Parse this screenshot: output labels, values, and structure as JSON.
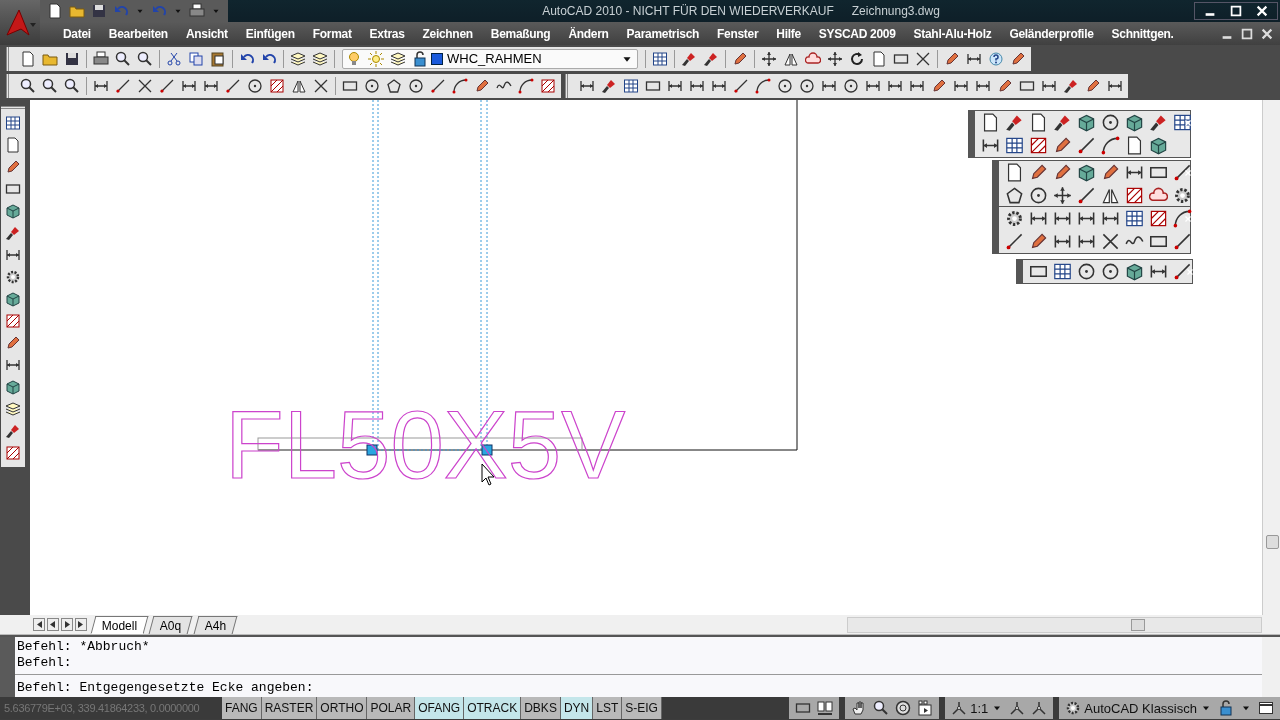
{
  "window": {
    "title": "AutoCAD 2010 - NICHT FÜR DEN WIEDERVERKAUF",
    "document": "Zeichnung3.dwg"
  },
  "menu": [
    "Datei",
    "Bearbeiten",
    "Ansicht",
    "Einfügen",
    "Format",
    "Extras",
    "Zeichnen",
    "Bemaßung",
    "Ändern",
    "Parametrisch",
    "Fenster",
    "Hilfe",
    "SYSCAD 2009",
    "Stahl-Alu-Holz",
    "Geländerprofile",
    "Schnittgen."
  ],
  "layer_control": {
    "value": "WHC_RAHMEN"
  },
  "drawing": {
    "text": "FL50X5V"
  },
  "layout_tabs": [
    {
      "label": "Modell",
      "selected": true
    },
    {
      "label": "A0q",
      "selected": false
    },
    {
      "label": "A4h",
      "selected": false
    }
  ],
  "command_history": [
    "Befehl: *Abbruch*",
    "Befehl:"
  ],
  "command_prompt": "Befehl: Entgegengesetzte Ecke angeben:",
  "status_bar": {
    "coordinates": "5.636779E+03, 339.41864233, 0.0000000",
    "toggles": [
      {
        "label": "FANG",
        "on": false
      },
      {
        "label": "RASTER",
        "on": false
      },
      {
        "label": "ORTHO",
        "on": false
      },
      {
        "label": "POLAR",
        "on": false
      },
      {
        "label": "OFANG",
        "on": true
      },
      {
        "label": "OTRACK",
        "on": true
      },
      {
        "label": "DBKS",
        "on": false
      },
      {
        "label": "DYN",
        "on": true
      },
      {
        "label": "LST",
        "on": false
      },
      {
        "label": "S-EIG",
        "on": false
      }
    ],
    "annotation_scale": "1:1",
    "workspace": "AutoCAD Klassisch"
  }
}
